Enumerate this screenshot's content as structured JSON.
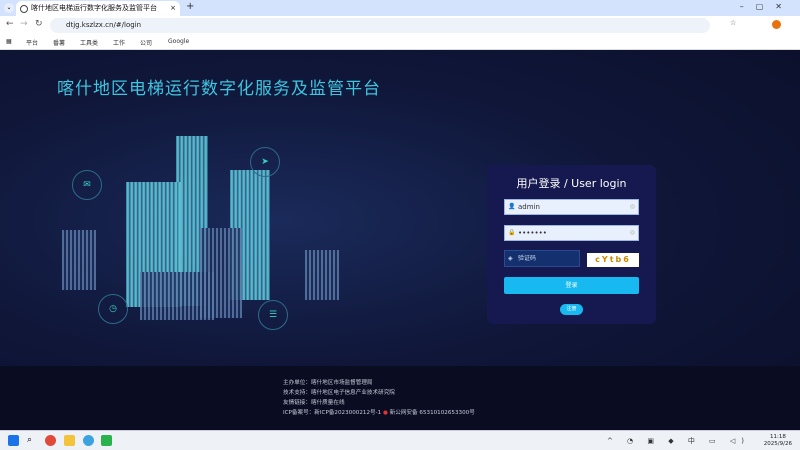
{
  "browser": {
    "tab_title": "喀什地区电梯运行数字化服务及监管平台",
    "url": "dtjg.kszlzx.cn/#/login",
    "bookmarks": [
      "平台",
      "番薯",
      "工具类",
      "工作",
      "公司",
      "Google"
    ]
  },
  "page": {
    "title": "喀什地区电梯运行数字化服务及监管平台"
  },
  "login": {
    "heading": "用户登录 / User login",
    "username": "admin",
    "password": "•••••••",
    "captcha_placeholder": "验证码",
    "captcha_image_text": "cYtb6",
    "login_button": "登录",
    "register_button": "注册"
  },
  "footer": {
    "host": "主办单位：喀什地区市场监督管理局",
    "support": "技术支持：喀什地区电子信息产业技术研究院",
    "links": "友情链接：喀什质量在线",
    "icp": "ICP备案号：新ICP备2023000212号-1",
    "police": "新公网安备 65310102653300号"
  },
  "taskbar": {
    "ime": "中",
    "time": "11:18",
    "date": "2025/9/26"
  }
}
